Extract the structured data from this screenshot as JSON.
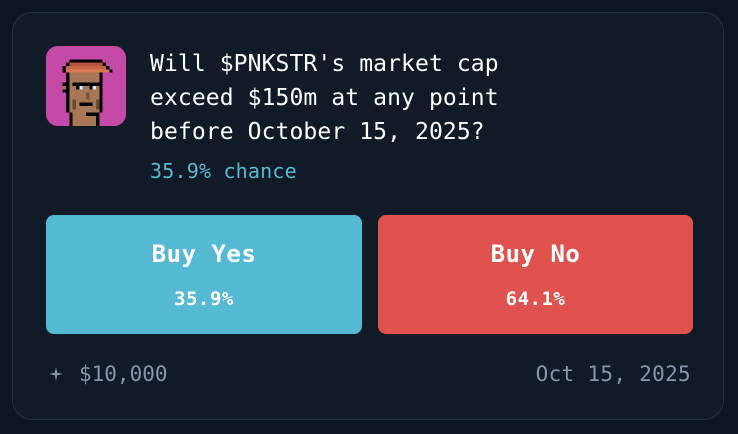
{
  "market": {
    "question": "Will $PNKSTR's market cap exceed $150m at any point before October 15, 2025?",
    "question_lines": [
      "Will $PNKSTR's market cap",
      "exceed $150m at any point",
      "before October 15, 2025?"
    ],
    "chance_text": "35.9% chance",
    "chance_value": 35.9
  },
  "buttons": {
    "yes": {
      "label": "Buy Yes",
      "percent": "35.9%"
    },
    "no": {
      "label": "Buy No",
      "percent": "64.1%"
    }
  },
  "footer": {
    "volume": "$10,000",
    "end_date": "Oct 15, 2025"
  },
  "colors": {
    "background": "#0f1520",
    "card": "#111a27",
    "yes": "#54b9d3",
    "no": "#e0524d",
    "chance": "#56b9d3",
    "muted": "#8795a8",
    "avatar_bg": "#c54aa7"
  },
  "icons": {
    "avatar": "cryptopunk-avatar-icon",
    "volume": "sparkle-icon"
  }
}
